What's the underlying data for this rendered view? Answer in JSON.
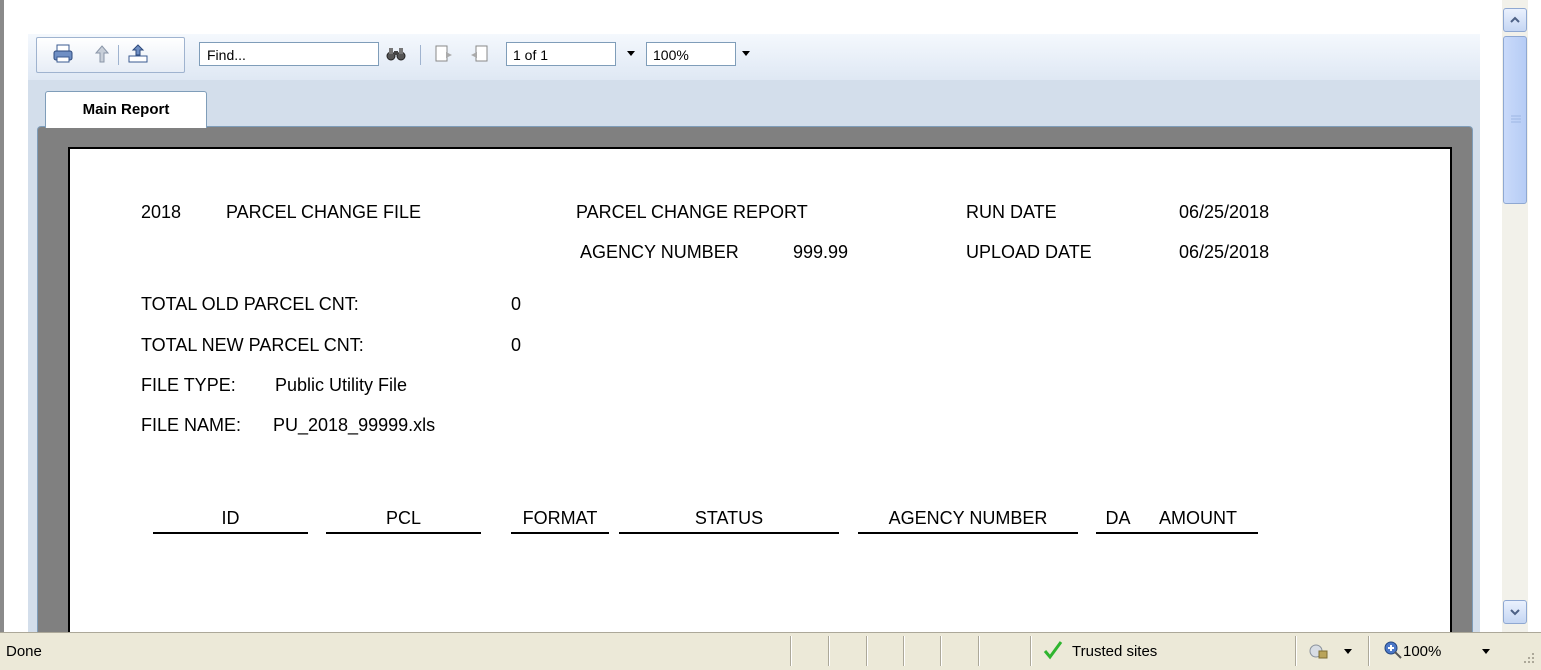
{
  "toolbar": {
    "find_placeholder": "Find...",
    "page_indicator": "1 of 1",
    "zoom": "100%"
  },
  "tab": {
    "label": "Main Report"
  },
  "report": {
    "year": "2018",
    "file_title": "PARCEL CHANGE FILE",
    "report_title": "PARCEL CHANGE REPORT",
    "agency_number_label": "AGENCY NUMBER",
    "agency_number_value": "999.99",
    "run_date_label": "RUN DATE",
    "run_date_value": "06/25/2018",
    "upload_date_label": "UPLOAD DATE",
    "upload_date_value": "06/25/2018",
    "old_parcel_label": "TOTAL OLD PARCEL CNT:",
    "old_parcel_value": "0",
    "new_parcel_label": "TOTAL NEW PARCEL CNT:",
    "new_parcel_value": "0",
    "file_type_label": "FILE TYPE:",
    "file_type_value": "Public Utility File",
    "file_name_label": "FILE NAME:",
    "file_name_value": "PU_2018_99999.xls",
    "columns": [
      "ID",
      "PCL",
      "FORMAT",
      "STATUS",
      "AGENCY NUMBER",
      "DA",
      "AMOUNT"
    ]
  },
  "statusbar": {
    "status": "Done",
    "zone": "Trusted sites",
    "zoom": "100%"
  },
  "colors": {
    "toolbar_bg": "#dfe8f4",
    "frame_gray": "#808080",
    "statusbar_bg": "#ece9d8",
    "check_green": "#2fb52f"
  }
}
